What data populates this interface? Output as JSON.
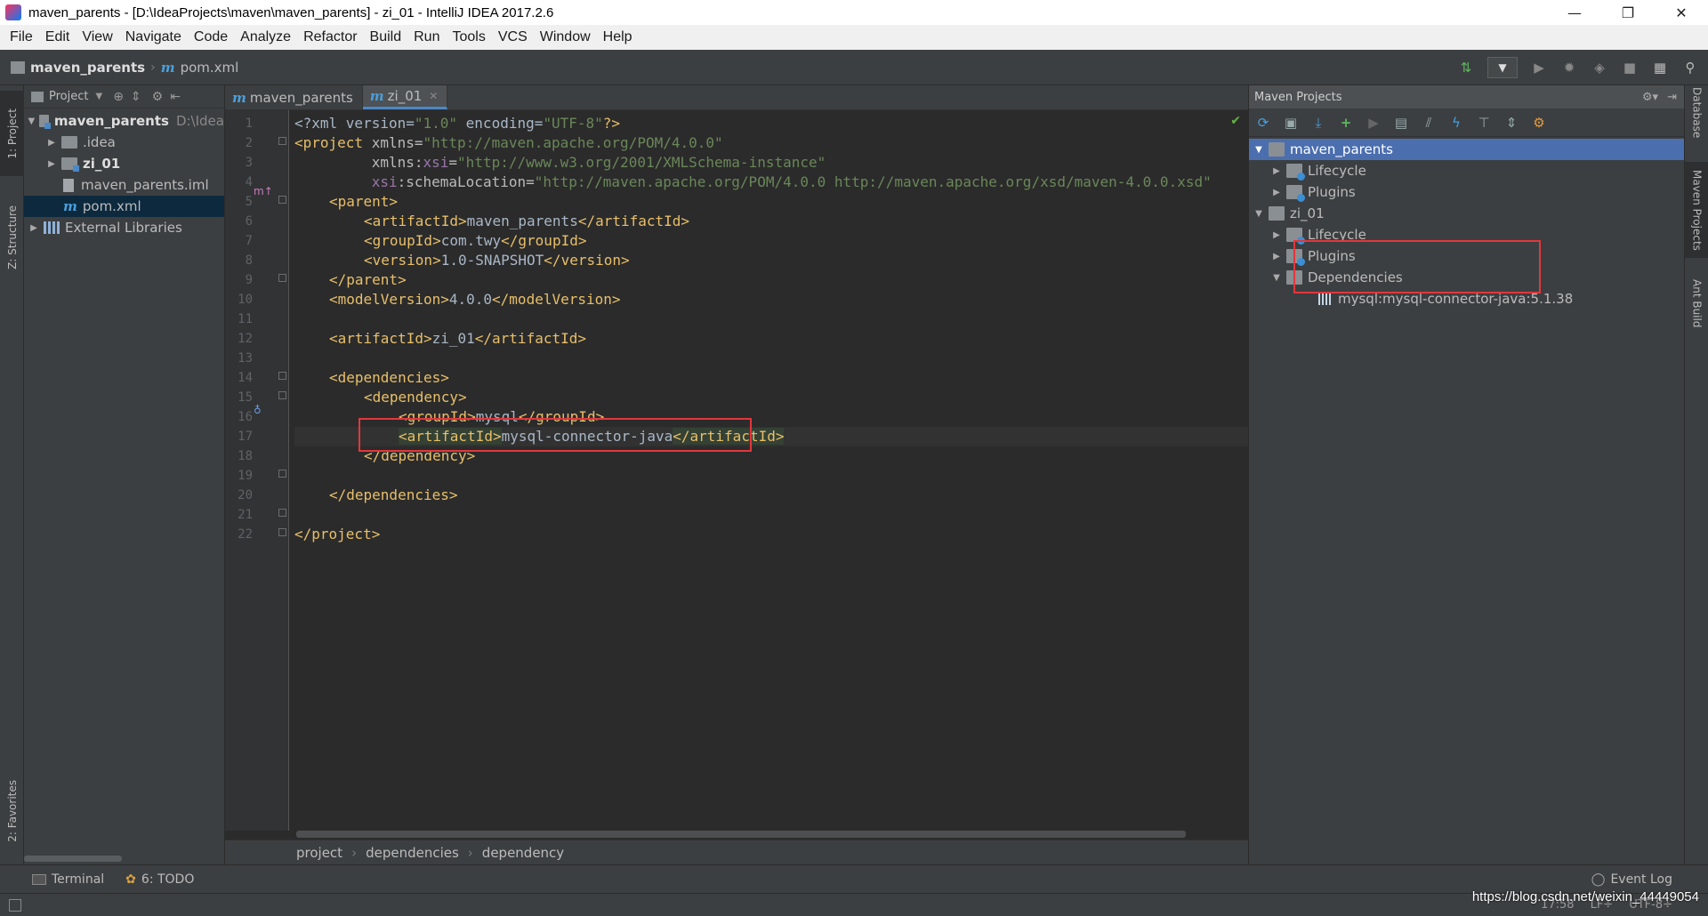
{
  "window": {
    "title": "maven_parents - [D:\\IdeaProjects\\maven\\maven_parents] - zi_01 - IntelliJ IDEA 2017.2.6",
    "minimize": "—",
    "restore": "❐",
    "close": "✕"
  },
  "menu": [
    "File",
    "Edit",
    "View",
    "Navigate",
    "Code",
    "Analyze",
    "Refactor",
    "Build",
    "Run",
    "Tools",
    "VCS",
    "Window",
    "Help"
  ],
  "navbar": {
    "project": "maven_parents",
    "file": "pom.xml"
  },
  "left_tabs": {
    "project": "1: Project",
    "structure": "Z: Structure",
    "favorites": "2: Favorites"
  },
  "project_panel": {
    "header": "Project",
    "tree": [
      {
        "label": "maven_parents",
        "hint": "D:\\Idea",
        "expanded": true
      },
      {
        "label": ".idea"
      },
      {
        "label": "zi_01"
      },
      {
        "label": "maven_parents.iml"
      },
      {
        "label": "pom.xml",
        "selected": true
      },
      {
        "label": "External Libraries"
      }
    ]
  },
  "editor": {
    "tabs": [
      {
        "label": "maven_parents",
        "active": false
      },
      {
        "label": "zi_01",
        "active": true
      }
    ],
    "line_numbers": [
      "1",
      "2",
      "3",
      "4",
      "5",
      "6",
      "7",
      "8",
      "9",
      "10",
      "11",
      "12",
      "13",
      "14",
      "15",
      "16",
      "17",
      "18",
      "19",
      "20",
      "21",
      "22"
    ],
    "code": {
      "l1_a": "<?xml version=",
      "l1_b": "\"1.0\"",
      "l1_c": " encoding=",
      "l1_d": "\"UTF-8\"",
      "l1_e": "?>",
      "l2_a": "<project ",
      "l2_b": "xmlns=",
      "l2_c": "\"http://maven.apache.org/POM/4.0.0\"",
      "l3_a": "         xmlns:",
      "l3_b": "xsi",
      "l3_c": "=",
      "l3_d": "\"http://www.w3.org/2001/XMLSchema-instance\"",
      "l4_a": "         ",
      "l4_b": "xsi",
      "l4_c": ":schemaLocation=",
      "l4_d": "\"http://maven.apache.org/POM/4.0.0 http://maven.apache.org/xsd/maven-4.0.0.xsd\"",
      "l5_a": "<parent>",
      "l6_a": "<artifactId>",
      "l6_b": "maven_parents",
      "l6_c": "</artifactId>",
      "l7_a": "<groupId>",
      "l7_b": "com.twy",
      "l7_c": "</groupId>",
      "l8_a": "<version>",
      "l8_b": "1.0-SNAPSHOT",
      "l8_c": "</version>",
      "l9_a": "</parent>",
      "l10_a": "<modelVersion>",
      "l10_b": "4.0.0",
      "l10_c": "</modelVersion>",
      "l12_a": "<artifactId>",
      "l12_b": "zi_01",
      "l12_c": "</artifactId>",
      "l14_a": "<dependencies>",
      "l15_a": "<dependency>",
      "l16_a": "<groupId>",
      "l16_b": "mysql",
      "l16_c": "</groupId>",
      "l17_a": "<artifactId>",
      "l17_b": "mysql-connector-java",
      "l17_c": "</artifactId>",
      "l18_a": "</dependency>",
      "l20_a": "</dependencies>",
      "l22_a": "</project>"
    },
    "breadcrumbs": [
      "project",
      "dependencies",
      "dependency"
    ]
  },
  "maven_panel": {
    "title": "Maven Projects",
    "tree": [
      {
        "label": "maven_parents",
        "selected": true
      },
      {
        "label": "Lifecycle"
      },
      {
        "label": "Plugins"
      },
      {
        "label": "zi_01"
      },
      {
        "label": "Lifecycle"
      },
      {
        "label": "Plugins"
      },
      {
        "label": "Dependencies"
      },
      {
        "label": "mysql:mysql-connector-java:5.1.38"
      }
    ]
  },
  "right_tabs": {
    "database": "Database",
    "maven": "Maven Projects",
    "ant": "Ant Build"
  },
  "bottom": {
    "terminal": "Terminal",
    "todo": "6: TODO",
    "event_log": "Event Log",
    "status_pos": "17:58",
    "status_sep": "LF÷",
    "status_enc": "UTF-8÷"
  },
  "watermark": "https://blog.csdn.net/weixin_44449054",
  "colors": {
    "background": "#2b2b2b",
    "panel": "#3c3f41",
    "selection": "#4b6eaf",
    "tag": "#e8bf6a",
    "string": "#6a8759",
    "highlight_box": "#e2373c"
  }
}
